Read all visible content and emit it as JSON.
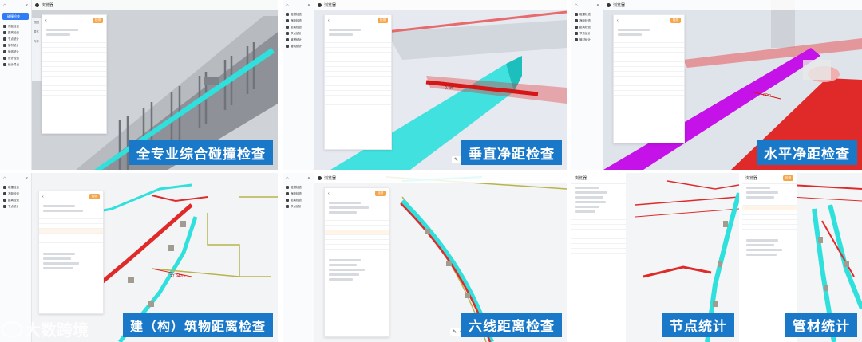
{
  "common": {
    "browser_title": "浏览器",
    "sidebar_items": [
      "碰撞检查",
      "净距检查",
      "距离检查",
      "节点统计",
      "管材统计",
      "管线统计",
      "设计检查",
      "统计导出"
    ],
    "tabs": [
      "视图",
      "属性",
      "构件"
    ],
    "panel_button": "检测"
  },
  "tiles": [
    {
      "label": "全专业综合碰撞检查",
      "theme": "clash"
    },
    {
      "label": "垂直净距检查",
      "theme": "vertical"
    },
    {
      "label": "水平净距检查",
      "theme": "horizontal"
    },
    {
      "label": "建（构）筑物距离检查",
      "theme": "building"
    },
    {
      "label": "六线距离检查",
      "theme": "sixline"
    },
    {
      "label": "节点统计",
      "theme": "node"
    },
    {
      "label": "管材统计",
      "theme": "pipe"
    }
  ],
  "annotations": {
    "vertical_measure": "0.4m",
    "horizontal_measure": "1.00m",
    "building_measure": "27.942m"
  },
  "brand": {
    "logo_text": "大数跨境"
  },
  "colors": {
    "label_bg": "#1a78c9",
    "cyan": "#2fe0dd",
    "red": "#e02a2a",
    "magenta": "#c412e8",
    "olive": "#b8b44a",
    "accent_orange": "#f5a54a",
    "sidebar_active": "#2f7cf6"
  }
}
